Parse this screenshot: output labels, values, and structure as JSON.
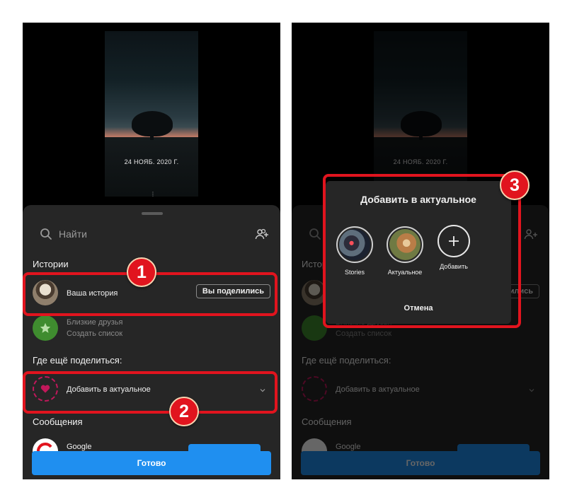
{
  "story_preview": {
    "date": "24 НОЯБ. 2020 Г."
  },
  "sheet": {
    "search_placeholder": "Найти",
    "stories_section": "Истории",
    "your_story": {
      "label": "Ваша история",
      "button": "Вы поделились"
    },
    "close_friends": {
      "label": "Близкие друзья",
      "sub": "Создать список"
    },
    "share_section": "Где ещё поделиться:",
    "add_to_highlights": "Добавить в актуальное",
    "messages_section": "Сообщения",
    "google_contact": "Google",
    "done_button": "Готово"
  },
  "dialog": {
    "title": "Добавить в актуальное",
    "items": [
      {
        "label": "Stories"
      },
      {
        "label": "Актуальное"
      },
      {
        "label": "Добавить"
      }
    ],
    "cancel": "Отмена"
  },
  "callouts": [
    "1",
    "2",
    "3"
  ],
  "colors": {
    "accent_blue": "#1f8ff0",
    "callout_red": "#e1141e",
    "sheet_bg": "#262626",
    "highlight_pink": "#c2185b"
  }
}
